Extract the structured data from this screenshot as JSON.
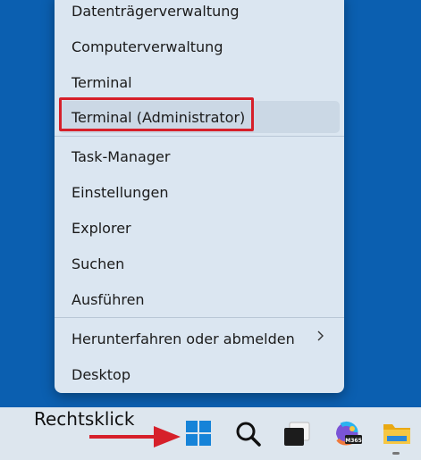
{
  "menu": {
    "items": [
      {
        "label": "Datenträgerverwaltung"
      },
      {
        "label": "Computerverwaltung"
      },
      {
        "label": "Terminal"
      },
      {
        "label": "Terminal (Administrator)"
      },
      {
        "label": "Task-Manager"
      },
      {
        "label": "Einstellungen"
      },
      {
        "label": "Explorer"
      },
      {
        "label": "Suchen"
      },
      {
        "label": "Ausführen"
      },
      {
        "label": "Herunterfahren oder abmelden"
      },
      {
        "label": "Desktop"
      }
    ],
    "chevron_icon": "chevron-right-icon"
  },
  "annotation": {
    "label": "Rechtsklick",
    "color": "#d6202a"
  },
  "taskbar": {
    "icons": [
      "windows-start-icon",
      "search-icon",
      "task-view-icon",
      "copilot-m365-icon",
      "file-explorer-icon"
    ],
    "m365_label": "M365"
  },
  "colors": {
    "desktop": "#0b5fb0",
    "menu_bg": "#dbe6f1",
    "highlight": "#d6202a",
    "start_blue": "#1683d8"
  }
}
